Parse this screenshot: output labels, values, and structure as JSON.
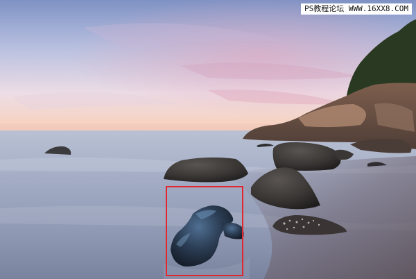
{
  "watermark": {
    "text": "PS教程论坛 WWW.16XX8.COM"
  },
  "highlight": {
    "border_color": "#e3262d"
  },
  "scene": {
    "subject": "long-exposure seascape at dusk with rocks in smooth water",
    "colors": {
      "sky_top": "#8b9bc9",
      "sky_horizon": "#f2c4b8",
      "sea": "#9aa6bf",
      "rock": "#3a3b3e",
      "cliff": "#7a5a48"
    }
  }
}
